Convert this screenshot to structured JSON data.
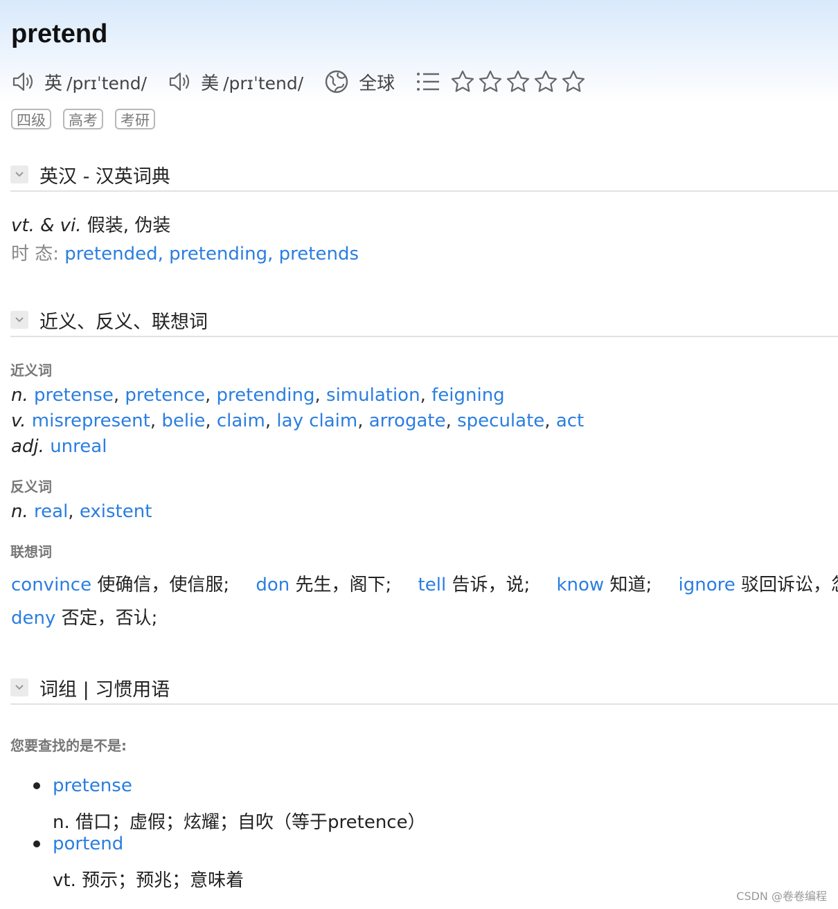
{
  "word": "pretend",
  "pronunciations": [
    {
      "label": "英",
      "ipa": "/prɪˈtend/"
    },
    {
      "label": "美",
      "ipa": "/prɪˈtend/"
    }
  ],
  "global_label": "全球",
  "tags": [
    "四级",
    "高考",
    "考研"
  ],
  "sections": {
    "dict": {
      "title": "英汉 - 汉英词典",
      "def_pos": "vt. & vi.",
      "def_text": "假装, 伪装",
      "tense_label": "时 态:",
      "tenses": [
        "pretended,",
        "pretending,",
        "pretends"
      ]
    },
    "related": {
      "title": "近义、反义、联想词",
      "synonyms_head": "近义词",
      "syn_n_pos": "n.",
      "syn_n": [
        "pretense",
        "pretence",
        "pretending",
        "simulation",
        "feigning"
      ],
      "syn_v_pos": "v.",
      "syn_v": [
        "misrepresent",
        "belie",
        "claim",
        "lay claim",
        "arrogate",
        "speculate",
        "act"
      ],
      "syn_adj_pos": "adj.",
      "syn_adj": [
        "unreal"
      ],
      "antonyms_head": "反义词",
      "ant_n_pos": "n.",
      "ant_n": [
        "real",
        "existent"
      ],
      "assoc_head": "联想词",
      "assoc": [
        {
          "word": "convince",
          "cn": "使确信，使信服;"
        },
        {
          "word": "don",
          "cn": "先生，阁下;"
        },
        {
          "word": "tell",
          "cn": "告诉，说;"
        },
        {
          "word": "know",
          "cn": "知道;"
        },
        {
          "word": "ignore",
          "cn": "驳回诉讼，忽视,"
        }
      ],
      "assoc2": [
        {
          "word": "deny",
          "cn": "否定，否认;"
        }
      ]
    },
    "phrases": {
      "title": "词组 | 习惯用语",
      "suggest_head": "您要查找的是不是:",
      "suggestions": [
        {
          "word": "pretense",
          "def": "n. 借口；虚假；炫耀；自吹（等于pretence）"
        },
        {
          "word": "portend",
          "def": "vt. 预示；预兆；意味着"
        }
      ]
    }
  },
  "watermark": "CSDN @卷卷编程",
  "icons": [
    "speaker-icon",
    "globe-icon",
    "list-icon",
    "star-icon",
    "chevron-down-icon"
  ],
  "colors": {
    "link": "#2a7ee0",
    "header_gradient": "#d8e9fb"
  }
}
